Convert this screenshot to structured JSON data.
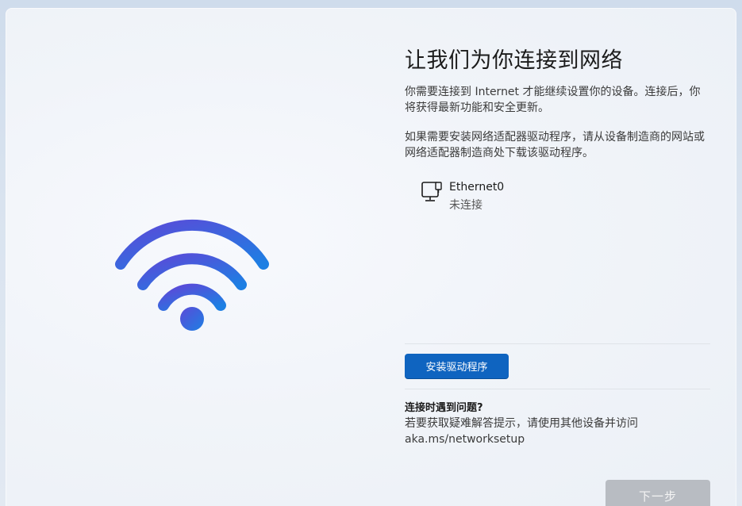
{
  "page": {
    "title": "让我们为你连接到网络",
    "paragraph1": "你需要连接到 Internet 才能继续设置你的设备。连接后，你将获得最新功能和安全更新。",
    "paragraph2": "如果需要安装网络适配器驱动程序，请从设备制造商的网站或网络适配器制造商处下载该驱动程序。"
  },
  "network": {
    "name": "Ethernet0",
    "status": "未连接",
    "icon": "ethernet-icon"
  },
  "actions": {
    "install_label": "安装驱动程序",
    "next_label": "下一步"
  },
  "help": {
    "title": "连接时遇到问题?",
    "text": "若要获取疑难解答提示，请使用其他设备并访问 aka.ms/networksetup"
  },
  "colors": {
    "accent": "#0f64c0",
    "wifi_gradient_start": "#5a4fd6",
    "wifi_gradient_end": "#1e78e0",
    "disabled_button": "#b8bcc2"
  }
}
